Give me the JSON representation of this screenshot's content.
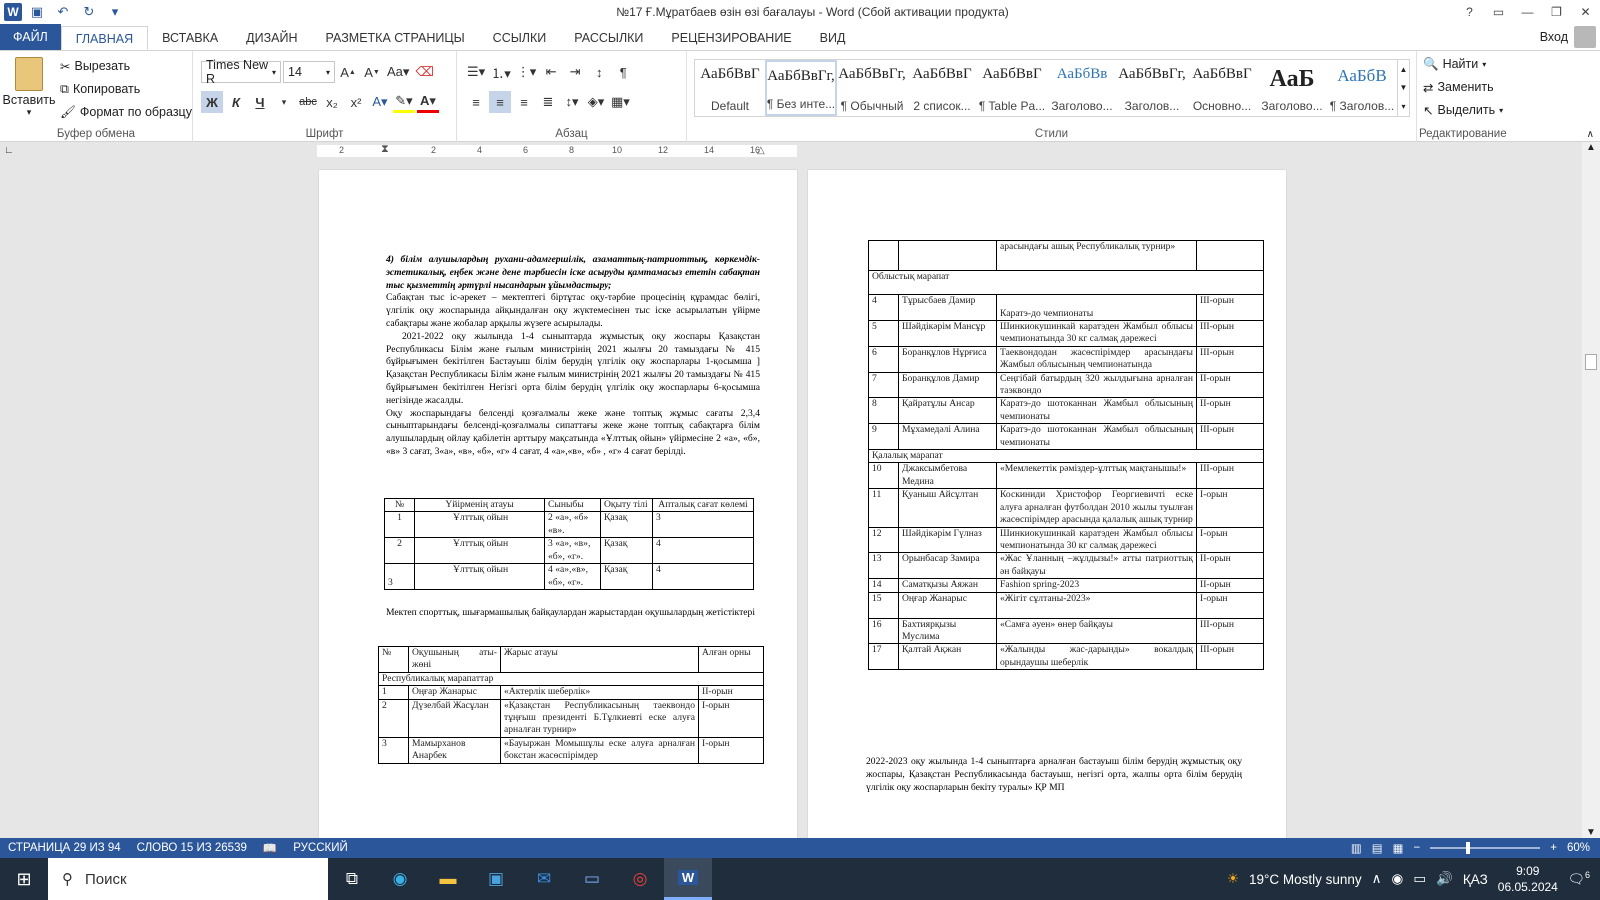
{
  "titlebar": {
    "title": "№17 Ғ.Мұратбаев өзін өзі бағалауы - Word (Сбой активации продукта)",
    "help": "?",
    "logo": "W"
  },
  "tabs": [
    {
      "label": "ФАЙЛ"
    },
    {
      "label": "ГЛАВНАЯ"
    },
    {
      "label": "ВСТАВКА"
    },
    {
      "label": "ДИЗАЙН"
    },
    {
      "label": "РАЗМЕТКА СТРАНИЦЫ"
    },
    {
      "label": "ССЫЛКИ"
    },
    {
      "label": "РАССЫЛКИ"
    },
    {
      "label": "РЕЦЕНЗИРОВАНИЕ"
    },
    {
      "label": "ВИД"
    }
  ],
  "signin": "Вход",
  "clipboard": {
    "paste": "Вставить",
    "cut": "Вырезать",
    "copy": "Копировать",
    "format_painter": "Формат по образцу",
    "label": "Буфер обмена"
  },
  "font": {
    "family": "Times New R",
    "size": "14",
    "label": "Шрифт",
    "bold": "Ж",
    "italic": "К",
    "underline": "Ч",
    "strike": "abc",
    "sub": "x₂",
    "sup": "x²"
  },
  "paragraph": {
    "label": "Абзац"
  },
  "styles": {
    "label": "Стили",
    "items": [
      {
        "sample": "АаБбВвГ",
        "name": "Default"
      },
      {
        "sample": "АаБбВвГг,",
        "name": "¶ Без инте..."
      },
      {
        "sample": "АаБбВвГг,",
        "name": "¶ Обычный"
      },
      {
        "sample": "АаБбВвГ",
        "name": "2 список..."
      },
      {
        "sample": "АаБбВвГ",
        "name": "¶ Table Pa..."
      },
      {
        "sample": "АаБбВв",
        "name": "Заголово..."
      },
      {
        "sample": "АаБбВвГг,",
        "name": "Заголов..."
      },
      {
        "sample": "АаБбВвГ",
        "name": "Основно..."
      },
      {
        "sample": "АаБ",
        "name": "Заголово..."
      },
      {
        "sample": "АаБбВ",
        "name": "¶ Заголов..."
      }
    ]
  },
  "editing": {
    "label": "Редактирование",
    "find": "Найти",
    "replace": "Заменить",
    "select": "Выделить"
  },
  "ruler": [
    "2",
    "2",
    "4",
    "6",
    "8",
    "10",
    "12",
    "14",
    "16"
  ],
  "page1": {
    "heading": "4) білім алушылардың рухани-адамгершілік, азаматтық-патриоттық, көркемдік-эстетикалық, еңбек және дене тәрбиесін іске асыруды қамтамасыз ететін сабақтан тыс қызметтің әртүрлі нысандарын ұйымдастыру;",
    "paragraphs": [
      "Сабақтан тыс іс-әрекет – мектептегі біртұтас оқу-тәрбие процесінің құрамдас бөлігі, үлгілік оқу жоспарында айқындалған оқу жүктемесінен тыс іске асырылатын үйірме сабақтары және жобалар арқылы жүзеге асырылады.",
      "2021-2022 оқу жылында 1-4 сыныптарда жұмыстық оқу жоспары Қазақстан Республикасы Білім және ғылым министрінің 2021 жылғы 20 тамыздағы № 415 бұйрығымен бекітілген Бастауыш білім берудің үлгілік оқу жоспарлары 1-қосымша ] Қазақстан Республикасы Білім және ғылым министрінің 2021 жылғы 20 тамыздағы № 415 бұйрығымен бекітілген Негізгі орта білім берудің үлгілік оқу жоспарлары 6-қосымша негізінде жасалды.",
      "Оқу жоспарындағы белсенді қозғалмалы жеке және топтық жұмыс сағаты 2,3,4 сыныптарындағы белсенді-қозғалмалы сипаттағы жеке және топтық сабақтарға білім алушылардың ойлау қабілетін арттыру мақсатында «Ұлттық ойын» үйірмесіне 2 «а», «б», «в» 3 сағат, 3«а», «в», «б», «г» 4 сағат, 4 «а»,«в», «б» , «г» 4 сағат берілді."
    ],
    "table1": {
      "headers": [
        "№",
        "Үйірменің атауы",
        "Сыныбы",
        "Оқыту тілі",
        "Апталық сағат көлемі"
      ],
      "rows": [
        [
          "1",
          "Ұлттық ойын",
          "2 «а», «б» «в».",
          "Қазақ",
          "3"
        ],
        [
          "2",
          "Ұлттық ойын",
          "3 «а», «в», «б», «г».",
          "Қазақ",
          "4"
        ],
        [
          "3",
          "Ұлттық ойын",
          "4 «а»,«в», «б», «г».",
          "Қазақ",
          "4"
        ]
      ]
    },
    "caption": "Мектеп спорттық, шығармашылық байқаулардан жарыстардан оқушылардың жетістіктері",
    "table2": {
      "headers": [
        "№",
        "Оқушының аты-жөні",
        "Жарыс атауы",
        "Алған орны"
      ],
      "section": "Республикалық марапаттар",
      "rows": [
        [
          "1",
          "Оңғар Жанарыс",
          "«Актерлік шеберлік»",
          "ІІ-орын"
        ],
        [
          "2",
          "Дүзелбай Жасұлан",
          "«Қазақстан Республикасының таеквондо тұңғыш президенті Б.Тұлкиевті еске алуға арналған турнир»",
          "І-орын"
        ],
        [
          "3",
          "Мамырханов Анарбек",
          "«Бауыржан Момышұлы еске алуға арналған бокстан жасөспірімдер",
          "І-орын"
        ]
      ]
    }
  },
  "page2": {
    "top_row": [
      "",
      "",
      "арасындағы ашық Республикалық турнир»",
      ""
    ],
    "section_oblast": "Облыстық марапат",
    "rows_oblast": [
      [
        "4",
        "Тұрысбаев Дамир",
        "Каратэ-до чемпионаты",
        "ІІІ-орын"
      ],
      [
        "5",
        "Шәйдікәрім Мансұр",
        "Шинкиокушинкай каратэден Жамбыл облысы чемпионатында 30 кг салмақ дәрежесі",
        "ІІІ-орын"
      ],
      [
        "6",
        "Боранқұлов Нұрғиса",
        "Таеквондодан жасөспірімдер арасындағы Жамбыл облысының чемпионатында",
        "ІІІ-орын"
      ],
      [
        "7",
        "Боранқұлов Дамир",
        "Сеңгібай батырдың 320 жылдығына арналған таэквондо",
        "ІІ-орын"
      ],
      [
        "8",
        "Қайратұлы Ансар",
        "Каратэ-до шотоканнан Жамбыл облысының чемпионаты",
        "ІІ-орын"
      ],
      [
        "9",
        "Мұхамедәлі Алина",
        "Каратэ-до шотоканнан Жамбыл облысының чемпионаты",
        "ІІІ-орын"
      ]
    ],
    "section_city": "Қалалық марапат",
    "rows_city": [
      [
        "10",
        "Джаксымбетова Медина",
        "«Мемлекеттік рәміздер-ұлттық мақтанышы!»",
        "ІІІ-орын"
      ],
      [
        "11",
        "Қуаныш Айсұлтан",
        "Коскиниди Христофор Георгиевичті еске алуға арналған футболдан 2010 жылы туылған жасөспірімдер арасында қалалық ашық турнир",
        "І-орын"
      ],
      [
        "12",
        "Шәйдікәрім Гүлназ",
        "Шинкиокушинкай каратэден Жамбыл облысы чемпионатында 30 кг салмақ дәрежесі",
        "І-орын"
      ],
      [
        "13",
        "Орынбасар Замира",
        "«Жас Ұланның –жұлдызы!» атты патриоттық ән байқауы",
        "ІІ-орын"
      ],
      [
        "14",
        "Саматқызы Аяжан",
        "Fashion spring-2023",
        "ІІ-орын"
      ],
      [
        "15",
        "Оңғар Жанарыс",
        "«Жігіт сұлтаны-2023»",
        "І-орын"
      ],
      [
        "16",
        "Бахтиярқызы Муслима",
        "«Самға әуен» өнер байқауы",
        "ІІІ-орын"
      ],
      [
        "17",
        "Қалтай Ақжан",
        "«Жалынды жас-дарынды» вокалдық орындаушы шеберлік",
        "ІІІ-орын"
      ]
    ],
    "footer_text": "2022-2023 оқу жылында 1-4 сыныптарға арналған бастауыш білім берудің жұмыстық оқу жоспары, Қазақстан Республикасында бастауыш, негізгі орта, жалпы орта білім берудің үлгілік оқу жоспарларын бекіту туралы» ҚР МП"
  },
  "status": {
    "page": "СТРАНИЦА 29 ИЗ 94",
    "words": "СЛОВО 15 ИЗ 26539",
    "lang": "РУССКИЙ",
    "zoom": "60%"
  },
  "taskbar": {
    "search": "Поиск",
    "weather": "19°C  Mostly sunny",
    "lang": "ҚАЗ",
    "time": "9:09",
    "date": "06.05.2024",
    "notif_count": "6"
  },
  "colors": {
    "word_blue": "#2b579a",
    "taskbar": "#1f2d3d"
  }
}
